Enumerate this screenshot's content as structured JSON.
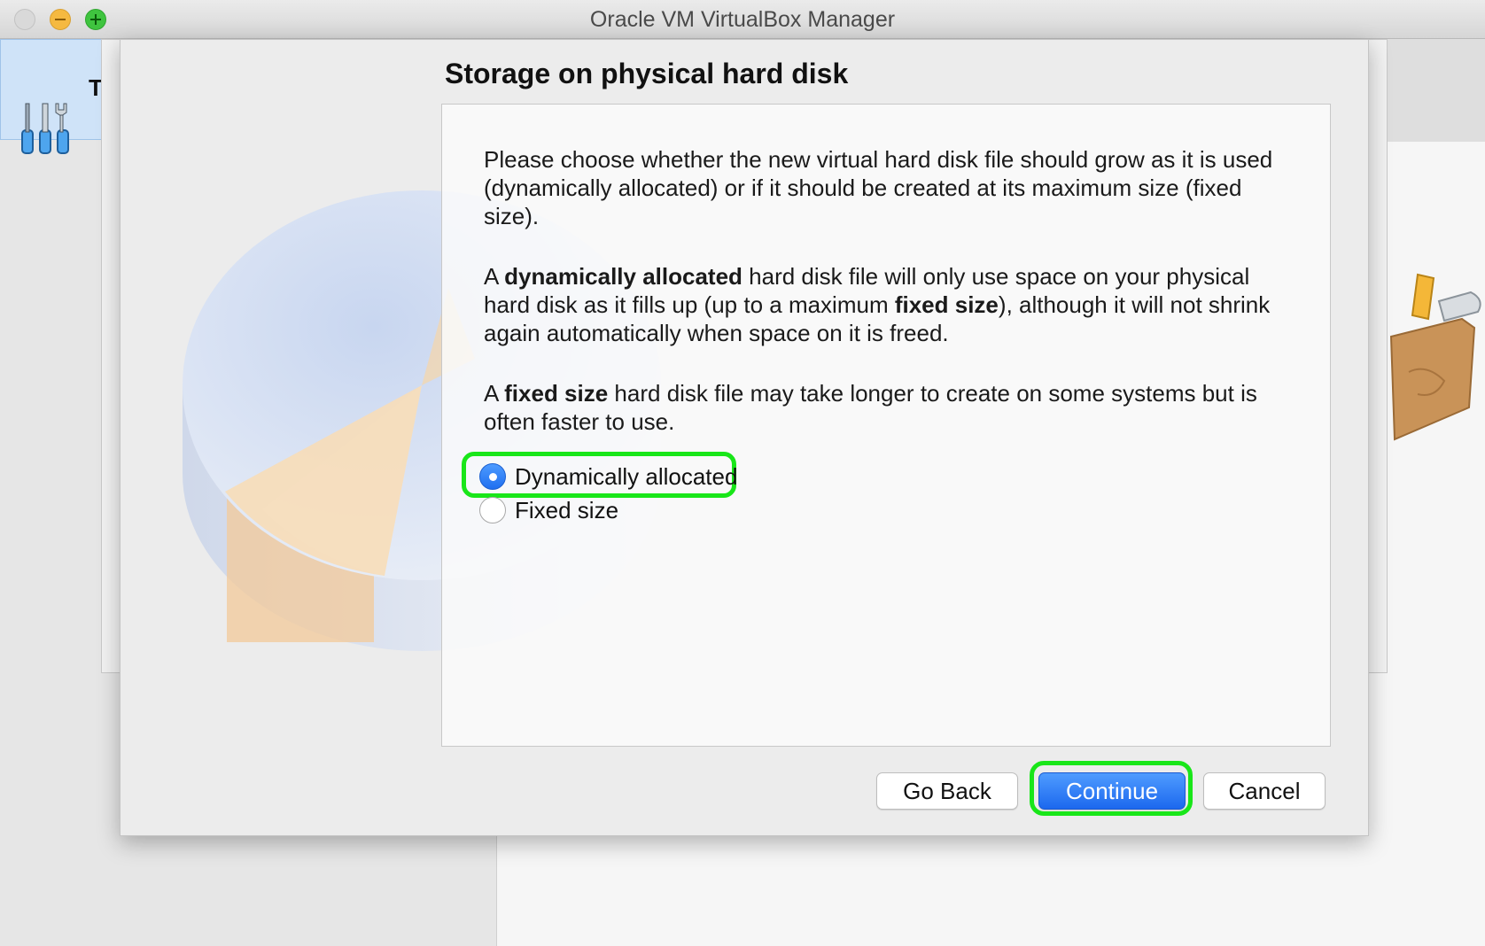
{
  "window": {
    "title": "Oracle VM VirtualBox Manager",
    "tools_label_partial": "T"
  },
  "dialog": {
    "title": "Storage on physical hard disk",
    "paragraphs": {
      "p1": "Please choose whether the new virtual hard disk file should grow as it is used (dynamically allocated) or if it should be created at its maximum size (fixed size).",
      "p2_a": "A ",
      "p2_b": "dynamically allocated",
      "p2_c": " hard disk file will only use space on your physical hard disk as it fills up (up to a maximum ",
      "p2_d": "fixed size",
      "p2_e": "), although it will not shrink again automatically when space on it is freed.",
      "p3_a": "A ",
      "p3_b": "fixed size",
      "p3_c": " hard disk file may take longer to create on some systems but is often faster to use."
    },
    "options": [
      {
        "label": "Dynamically allocated",
        "selected": true
      },
      {
        "label": "Fixed size",
        "selected": false
      }
    ],
    "buttons": {
      "back": "Go Back",
      "continue": "Continue",
      "cancel": "Cancel"
    }
  },
  "colors": {
    "accent": "#1f6ff0",
    "highlight": "#19e619"
  },
  "icons": [
    "close-icon",
    "minimize-icon",
    "zoom-icon",
    "tools-icon",
    "hard-disk-icon",
    "toolbox-icon"
  ]
}
